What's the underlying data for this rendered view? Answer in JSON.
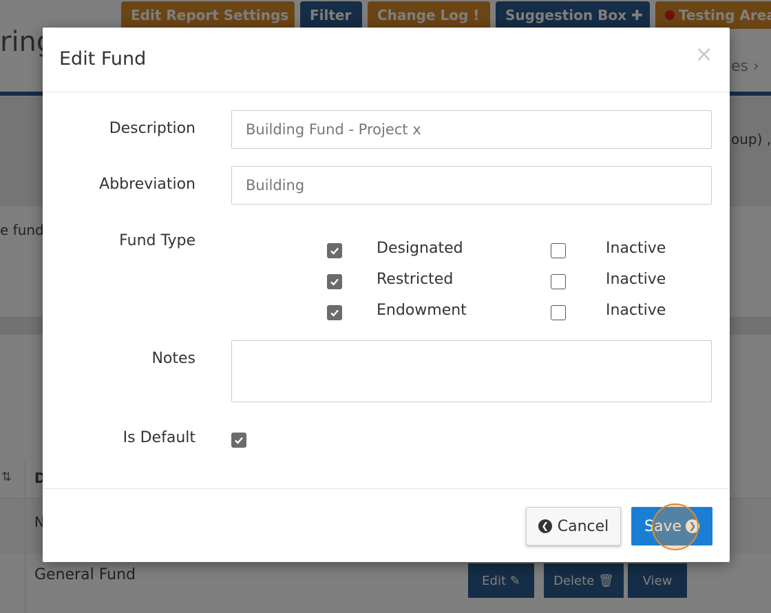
{
  "background": {
    "top_buttons": [
      {
        "label": "Edit Report Settings"
      },
      {
        "label": "Filter"
      },
      {
        "label": "Change Log !"
      },
      {
        "label": "Suggestion Box ✚"
      },
      {
        "label": "Testing Area"
      }
    ],
    "page_title_fragment": "ring",
    "right_link_fragment": "es ›",
    "right_text_fragment": "oup) , I",
    "left_text_fragment": "e fund",
    "table_header_fragment": "D",
    "grey_row_fragment": "N",
    "row_name": "General Fund",
    "row_buttons": {
      "edit": "Edit",
      "delete": "Delete",
      "view": "View"
    }
  },
  "modal": {
    "title": "Edit Fund",
    "close_symbol": "×",
    "fields": {
      "description": {
        "label": "Description",
        "value": "Building Fund - Project x"
      },
      "abbreviation": {
        "label": "Abbreviation",
        "value": "Building"
      },
      "fund_type": {
        "label": "Fund Type",
        "options": [
          {
            "label": "Designated",
            "checked": true,
            "inactive_label": "Inactive",
            "inactive_checked": false
          },
          {
            "label": "Restricted",
            "checked": true,
            "inactive_label": "Inactive",
            "inactive_checked": false
          },
          {
            "label": "Endowment",
            "checked": true,
            "inactive_label": "Inactive",
            "inactive_checked": false
          }
        ]
      },
      "notes": {
        "label": "Notes",
        "value": ""
      },
      "is_default": {
        "label": "Is Default",
        "checked": true
      }
    },
    "buttons": {
      "cancel": "Cancel",
      "save": "Save"
    }
  },
  "colors": {
    "primary": "#1a7fd4",
    "nav_blue": "#2b5b8e",
    "nav_orange": "#d98a2b",
    "checkbox_checked": "#6b6b6b"
  }
}
